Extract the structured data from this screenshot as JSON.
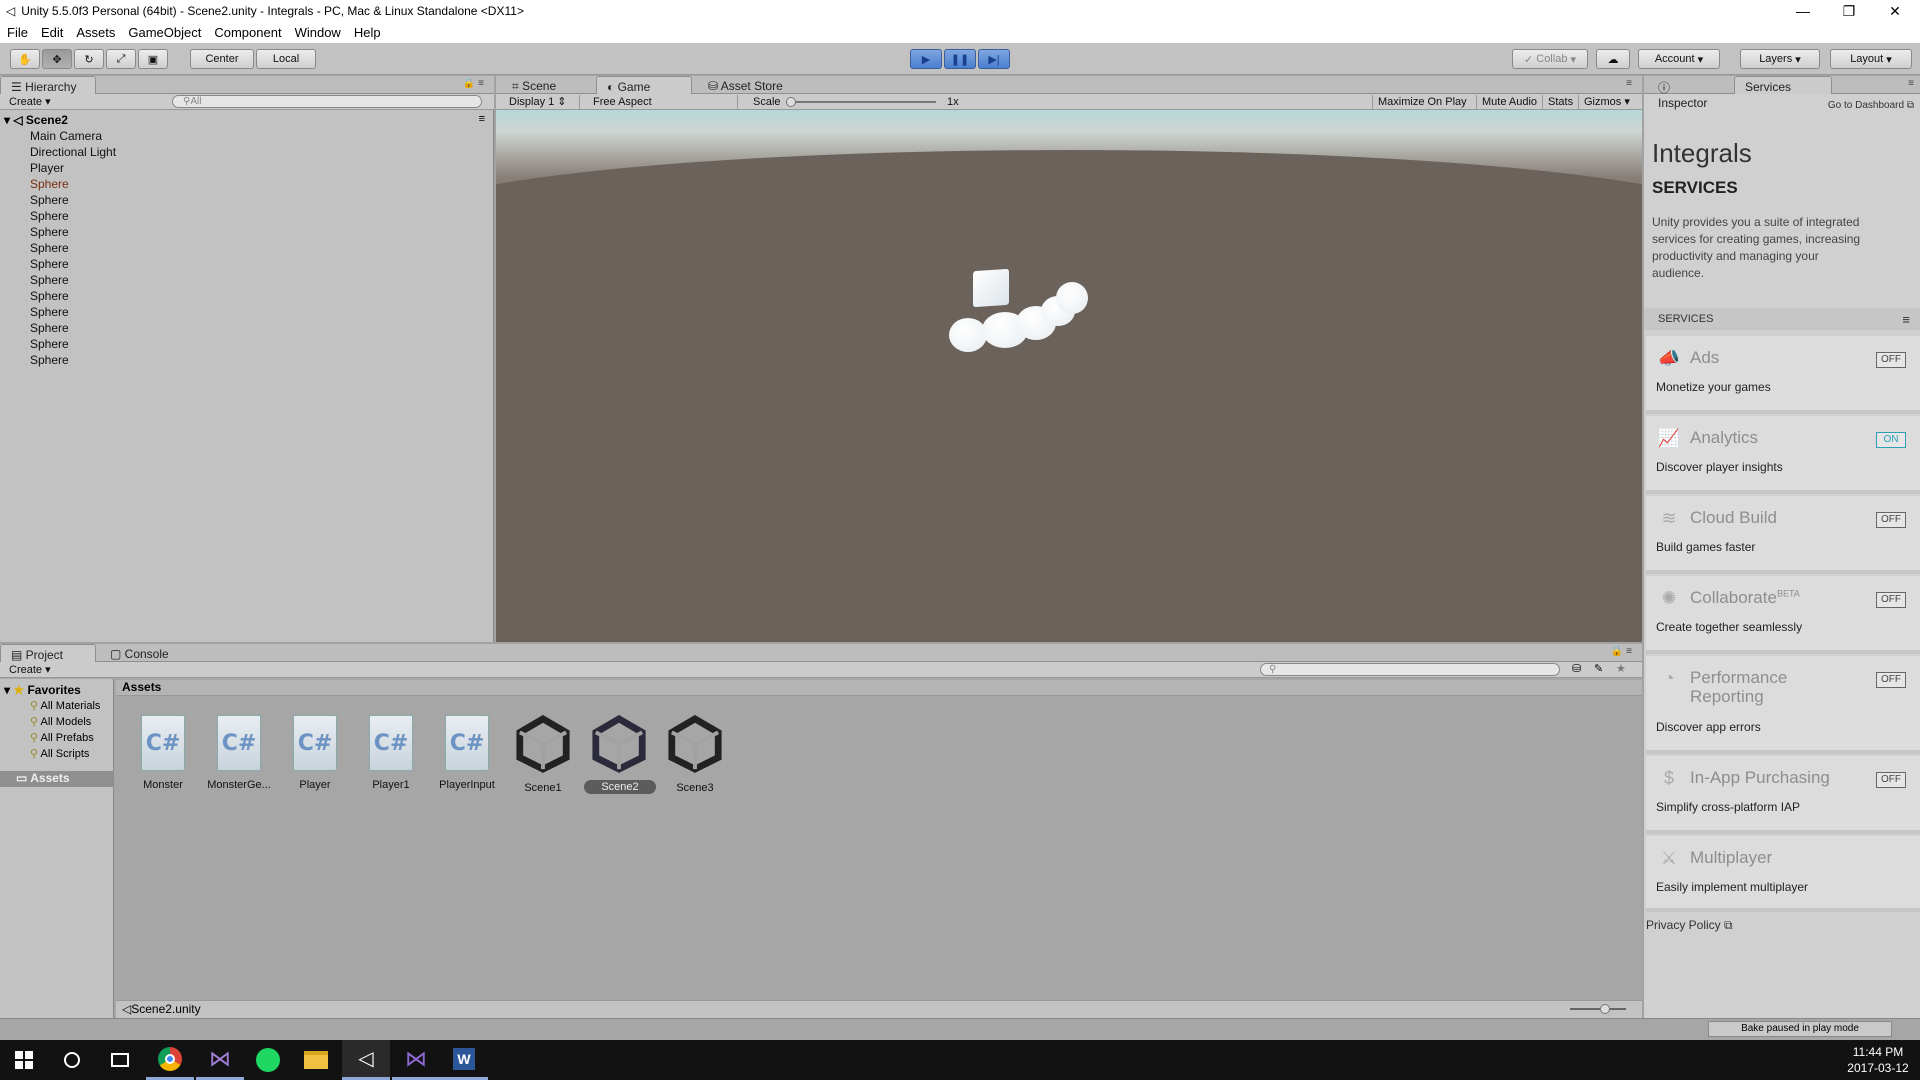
{
  "window": {
    "title": "Unity 5.5.0f3 Personal (64bit) - Scene2.unity - Integrals - PC, Mac & Linux Standalone <DX11>",
    "minimize": "—",
    "maximize": "❐",
    "close": "✕"
  },
  "menu": [
    "File",
    "Edit",
    "Assets",
    "GameObject",
    "Component",
    "Window",
    "Help"
  ],
  "toolbar": {
    "pivot": "Center",
    "space": "Local",
    "collab": "Collab",
    "account": "Account",
    "layers": "Layers",
    "layout": "Layout"
  },
  "hierarchy": {
    "tab": "Hierarchy",
    "create": "Create",
    "search_placeholder": "All",
    "scene": "Scene2",
    "items": [
      "Main Camera",
      "Directional Light",
      "Player",
      "Sphere",
      "Sphere",
      "Sphere",
      "Sphere",
      "Sphere",
      "Sphere",
      "Sphere",
      "Sphere",
      "Sphere",
      "Sphere",
      "Sphere",
      "Sphere"
    ]
  },
  "game": {
    "tabs": [
      "Scene",
      "Game",
      "Asset Store"
    ],
    "display": "Display 1",
    "aspect": "Free Aspect",
    "scale_label": "Scale",
    "scale_value": "1x",
    "maximize": "Maximize On Play",
    "mute": "Mute Audio",
    "stats": "Stats",
    "gizmos": "Gizmos"
  },
  "project": {
    "tabs": [
      "Project",
      "Console"
    ],
    "create": "Create",
    "favorites": "Favorites",
    "favorite_items": [
      "All Materials",
      "All Models",
      "All Prefabs",
      "All Scripts"
    ],
    "assets_root": "Assets",
    "breadcrumb": "Assets",
    "assets": [
      {
        "name": "Monster",
        "type": "script"
      },
      {
        "name": "MonsterGe...",
        "type": "script"
      },
      {
        "name": "Player",
        "type": "script"
      },
      {
        "name": "Player1",
        "type": "script"
      },
      {
        "name": "PlayerInput",
        "type": "script"
      },
      {
        "name": "Scene1",
        "type": "scene"
      },
      {
        "name": "Scene2",
        "type": "scene",
        "selected": true
      },
      {
        "name": "Scene3",
        "type": "scene"
      }
    ],
    "footer_path": "Scene2.unity"
  },
  "services": {
    "tabs": [
      "Inspector",
      "Services"
    ],
    "dashboard": "Go to Dashboard",
    "project_name": "Integrals",
    "heading": "SERVICES",
    "intro": "Unity provides you a suite of integrated services for creating games, increasing productivity and managing your audience.",
    "section_label": "SERVICES",
    "cards": [
      {
        "name": "Ads",
        "desc": "Monetize your games",
        "state": "OFF",
        "icon": "megaphone-icon"
      },
      {
        "name": "Analytics",
        "desc": "Discover player insights",
        "state": "ON",
        "icon": "chart-icon"
      },
      {
        "name": "Cloud Build",
        "desc": "Build games faster",
        "state": "OFF",
        "icon": "layers-icon"
      },
      {
        "name": "Collaborate",
        "sup": "BETA",
        "desc": "Create together seamlessly",
        "state": "OFF",
        "icon": "network-icon"
      },
      {
        "name": "Performance Reporting",
        "desc": "Discover app errors",
        "state": "OFF",
        "icon": "gauge-icon"
      },
      {
        "name": "In-App Purchasing",
        "desc": "Simplify cross-platform IAP",
        "state": "OFF",
        "icon": "dollar-icon"
      },
      {
        "name": "Multiplayer",
        "desc": "Easily implement multiplayer",
        "state": "",
        "icon": "swords-icon"
      }
    ],
    "privacy": "Privacy Policy"
  },
  "statusbar": {
    "bake": "Bake paused in play mode"
  },
  "taskbar": {
    "time": "11:44 PM",
    "date": "2017-03-12"
  }
}
